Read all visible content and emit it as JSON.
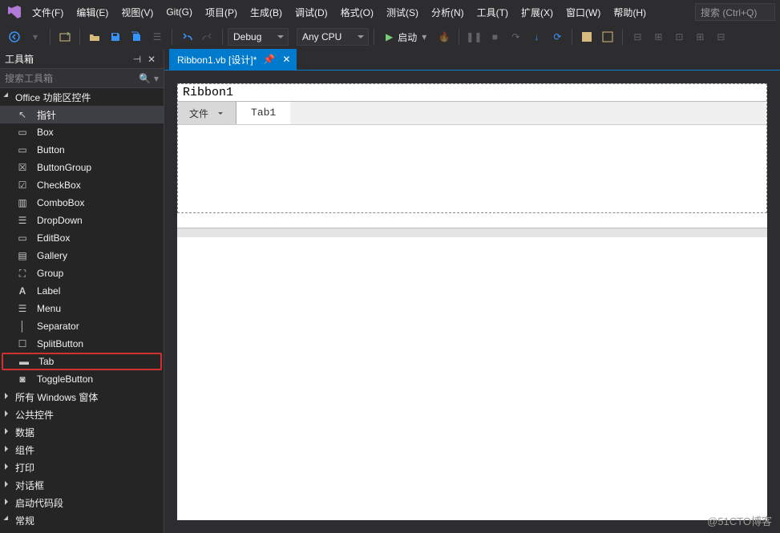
{
  "menubar": {
    "items": [
      "文件(F)",
      "编辑(E)",
      "视图(V)",
      "Git(G)",
      "项目(P)",
      "生成(B)",
      "调试(D)",
      "格式(O)",
      "测试(S)",
      "分析(N)",
      "工具(T)",
      "扩展(X)",
      "窗口(W)",
      "帮助(H)"
    ],
    "search_placeholder": "搜索 (Ctrl+Q)"
  },
  "toolbar": {
    "config": "Debug",
    "platform": "Any CPU",
    "start_label": "启动"
  },
  "toolbox": {
    "title": "工具箱",
    "search_placeholder": "搜索工具箱",
    "group_office": "Office 功能区控件",
    "items_office": [
      "指针",
      "Box",
      "Button",
      "ButtonGroup",
      "CheckBox",
      "ComboBox",
      "DropDown",
      "EditBox",
      "Gallery",
      "Group",
      "Label",
      "Menu",
      "Separator",
      "SplitButton",
      "Tab",
      "ToggleButton"
    ],
    "groups_collapsed": [
      "所有 Windows 窗体",
      "公共控件",
      "数据",
      "组件",
      "打印",
      "对话框",
      "启动代码段"
    ],
    "group_general": "常规"
  },
  "editor": {
    "tab_label": "Ribbon1.vb [设计]*",
    "ribbon_canvas_title": "Ribbon1",
    "ribbon_file_tab": "文件",
    "ribbon_tab1": "Tab1"
  },
  "watermark": "@51CTO博客"
}
